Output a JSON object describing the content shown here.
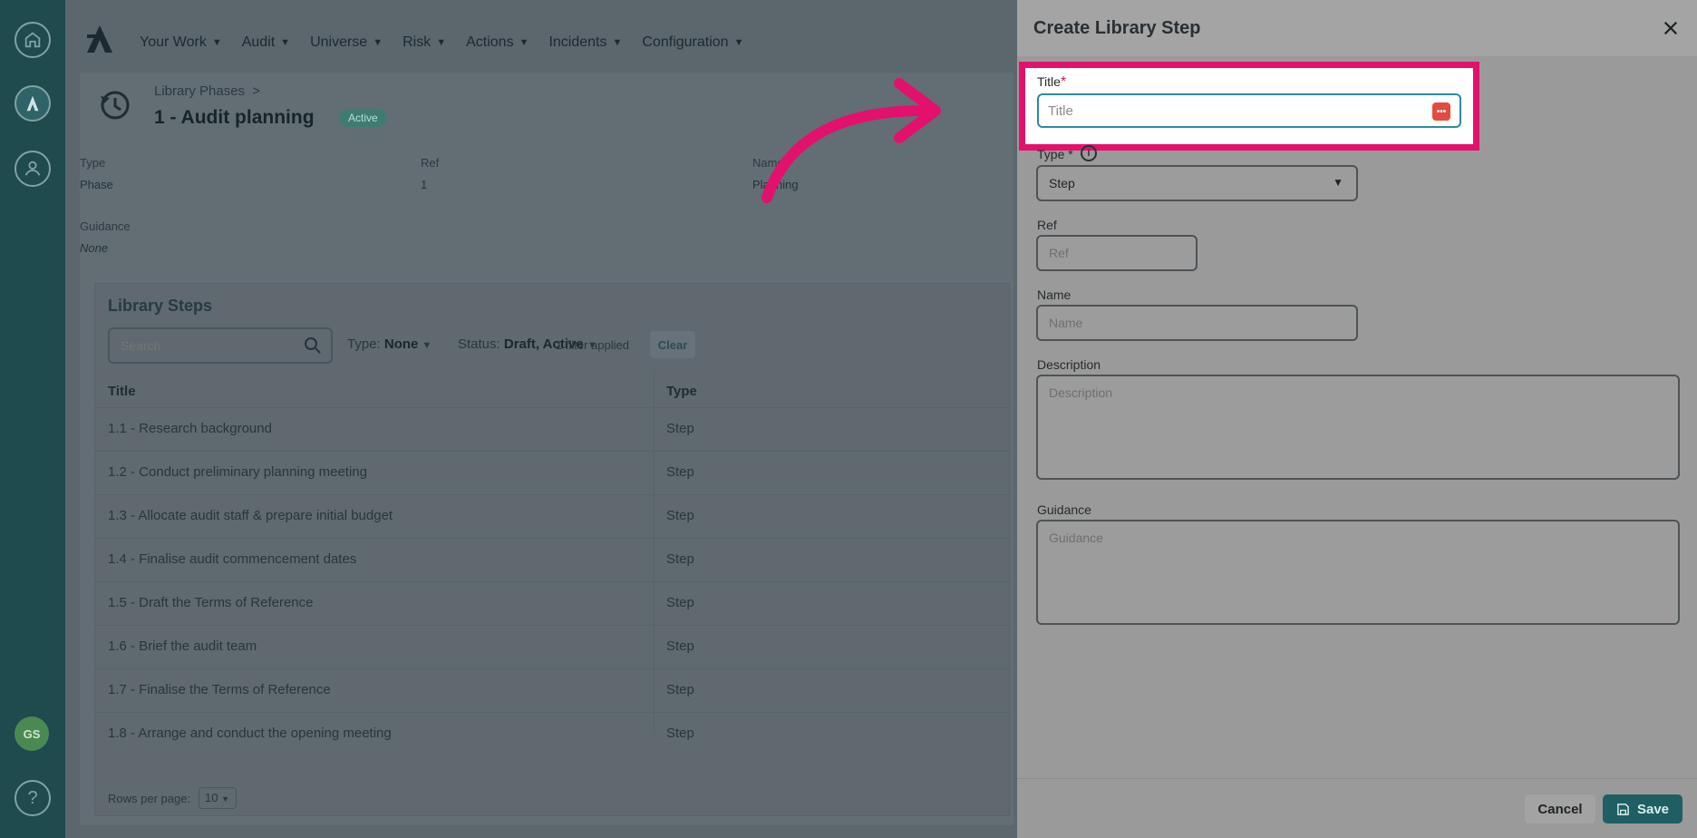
{
  "nav": {
    "items": [
      "Your Work",
      "Audit",
      "Universe",
      "Risk",
      "Actions",
      "Incidents",
      "Configuration"
    ]
  },
  "rail": {
    "avatar_initials": "GS",
    "help": "?"
  },
  "header": {
    "breadcrumb": "Library Phases",
    "breadcrumb_sep": ">",
    "title": "1 - Audit planning",
    "status": "Active"
  },
  "meta": {
    "type_label": "Type",
    "type_value": "Phase",
    "ref_label": "Ref",
    "ref_value": "1",
    "name_label": "Name",
    "name_value": "Planning",
    "guidance_label": "Guidance",
    "guidance_value": "None"
  },
  "steps": {
    "title": "Library Steps",
    "search_placeholder": "Search",
    "filter_type_label": "Type:",
    "filter_type_value": "None",
    "filter_status_label": "Status:",
    "filter_status_value": "Draft, Active",
    "filters_applied": "1 filter applied",
    "clear_label": "Clear",
    "columns": [
      "Title",
      "Type"
    ],
    "rows": [
      {
        "title": "1.1 - Research background",
        "type": "Step"
      },
      {
        "title": "1.2 - Conduct preliminary planning meeting",
        "type": "Step"
      },
      {
        "title": "1.3 - Allocate audit staff & prepare initial budget",
        "type": "Step"
      },
      {
        "title": "1.4 - Finalise audit commencement dates",
        "type": "Step"
      },
      {
        "title": "1.5 - Draft the Terms of Reference",
        "type": "Step"
      },
      {
        "title": "1.6 - Brief the audit team",
        "type": "Step"
      },
      {
        "title": "1.7 - Finalise the Terms of Reference",
        "type": "Step"
      },
      {
        "title": "1.8 - Arrange and conduct the opening meeting",
        "type": "Step"
      }
    ],
    "rows_per_page_label": "Rows per page:",
    "rows_per_page_value": "10"
  },
  "drawer": {
    "title": "Create Library Step",
    "title_label": "Title",
    "title_required": "*",
    "title_placeholder": "Title",
    "type_label": "Type",
    "type_required": "*",
    "type_value": "Step",
    "ref_label": "Ref",
    "ref_placeholder": "Ref",
    "name_label": "Name",
    "name_placeholder": "Name",
    "description_label": "Description",
    "description_placeholder": "Description",
    "guidance_label": "Guidance",
    "guidance_placeholder": "Guidance",
    "cancel_label": "Cancel",
    "save_label": "Save"
  },
  "colors": {
    "highlight": "#e3106e",
    "primary": "#1f5e63",
    "rail": "#1f4a4e"
  }
}
